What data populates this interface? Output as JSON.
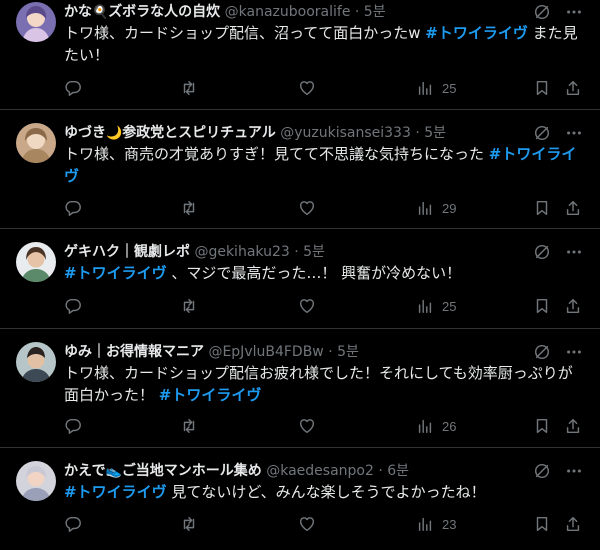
{
  "tweets": [
    {
      "name": "かな",
      "name_emoji": "🍳",
      "name_rest": "ズボラな人の自炊",
      "handle": "@kanazubooralife",
      "sep": "·",
      "time": "5분",
      "text_before": "トワ様、カードショップ配信、沼ってて面白かったw ",
      "hashtag": "#トワイライヴ",
      "text_after": " また見たい！",
      "views": "25"
    },
    {
      "name": "ゆづき",
      "name_emoji": "🌙",
      "name_rest": "参政党とスピリチュアル",
      "handle": "@yuzukisansei333",
      "sep": "·",
      "time": "5분",
      "text_before": "トワ様、商売の才覚ありすぎ！見てて不思議な気持ちになった ",
      "hashtag": "#トワイライヴ",
      "text_after": "",
      "views": "29"
    },
    {
      "name": "ゲキハク｜観劇レポ",
      "name_emoji": "",
      "name_rest": "",
      "handle": "@gekihaku23",
      "sep": "·",
      "time": "5분",
      "text_before": "",
      "hashtag": "#トワイライヴ",
      "text_after": " 、マジで最高だった…！ 興奮が冷めない！",
      "views": "25"
    },
    {
      "name": "ゆみ｜お得情報マニア",
      "name_emoji": "",
      "name_rest": "",
      "handle": "@EpJvluB4FDBw",
      "sep": "·",
      "time": "5분",
      "text_before": "トワ様、カードショップ配信お疲れ様でした！それにしても効率厨っぷりが面白かった！ ",
      "hashtag": "#トワイライヴ",
      "text_after": "",
      "views": "26"
    },
    {
      "name": "かえで",
      "name_emoji": "👟",
      "name_rest": "ご当地マンホール集め",
      "handle": "@kaedesanpo2",
      "sep": "·",
      "time": "6분",
      "text_before": "",
      "hashtag": "#トワイライヴ",
      "text_after": " 見てないけど、みんな楽しそうでよかったね！",
      "views": "23"
    }
  ],
  "icons": {
    "header": [
      "grok-icon",
      "more-icon"
    ],
    "actions": [
      "reply-icon",
      "retweet-icon",
      "like-icon",
      "views-icon",
      "bookmark-icon",
      "share-icon"
    ]
  },
  "colors": {
    "background": "#000000",
    "text": "#e7e9ea",
    "muted": "#71767b",
    "hashtag": "#1d9bf0",
    "divider": "#2f3336"
  }
}
